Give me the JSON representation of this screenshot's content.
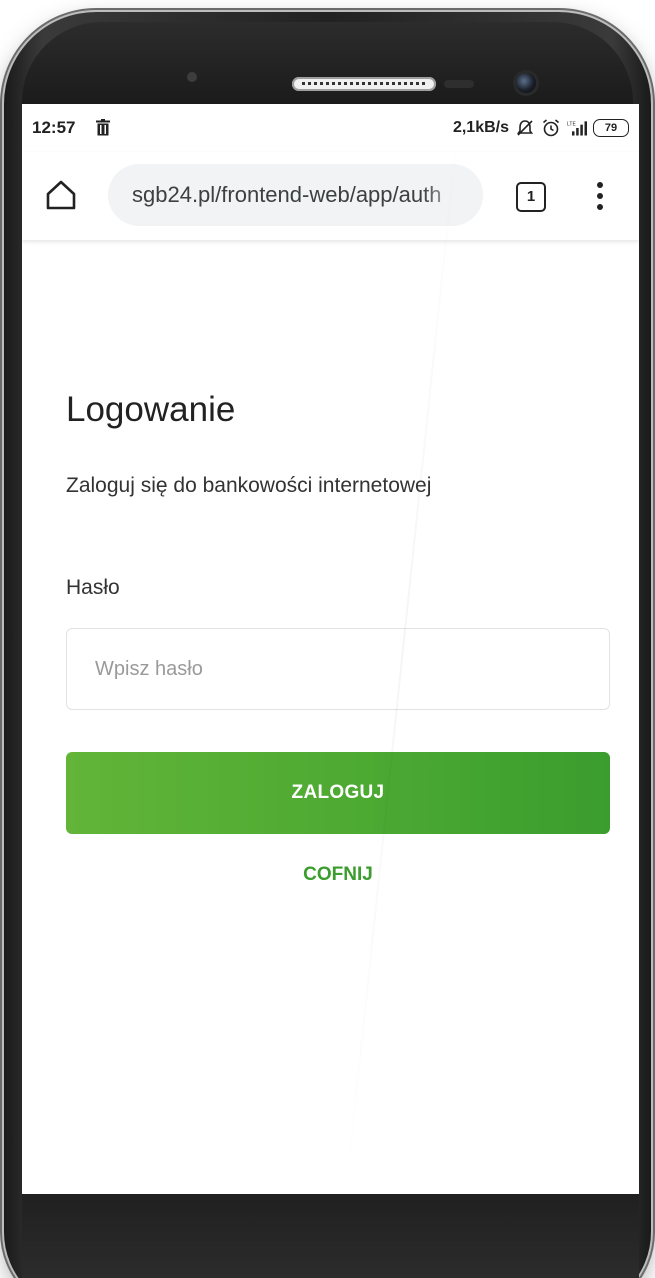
{
  "status_bar": {
    "time": "12:57",
    "net_speed": "2,1kB/s",
    "signal_label": "LTE",
    "battery": "79"
  },
  "browser": {
    "url": "sgb24.pl/frontend-web/app/auth",
    "tab_count": "1"
  },
  "page": {
    "title": "Logowanie",
    "subtitle": "Zaloguj się do bankowości internetowej",
    "password_label": "Hasło",
    "password_placeholder": "Wpisz hasło",
    "password_value": "",
    "login_button": "ZALOGUJ",
    "back_link": "COFNIJ"
  },
  "colors": {
    "brand_green": "#4aa832",
    "link_green": "#3b9d2e"
  }
}
